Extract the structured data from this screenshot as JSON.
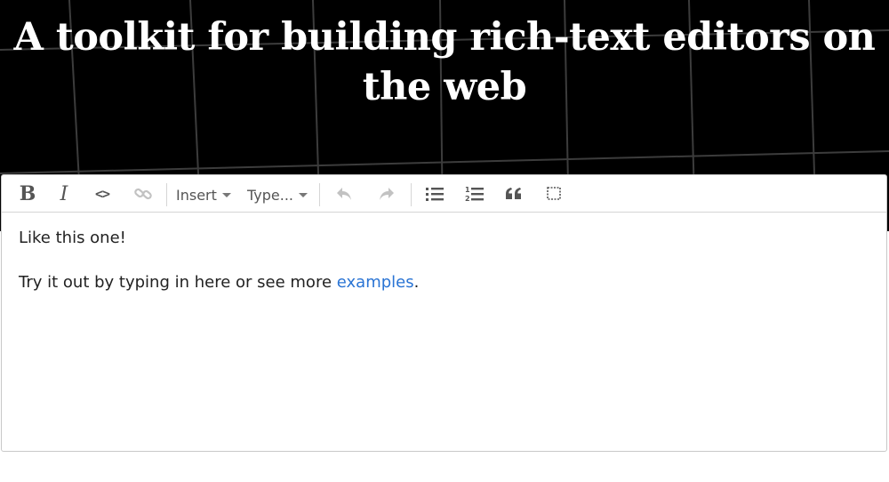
{
  "hero": {
    "title": "A toolkit for building rich-text editors on the web"
  },
  "toolbar": {
    "bold_label": "B",
    "italic_label": "I",
    "code_label": "<>",
    "insert_label": "Insert",
    "type_label": "Type..."
  },
  "content": {
    "paragraph1": "Like this one!",
    "paragraph2_prefix": "Try it out by typing in here or see more ",
    "paragraph2_link": "examples",
    "paragraph2_suffix": "."
  },
  "colors": {
    "hero_background": "#000000",
    "link": "#2a74d4",
    "icon": "#666666",
    "icon_disabled": "#bbbbbb"
  }
}
